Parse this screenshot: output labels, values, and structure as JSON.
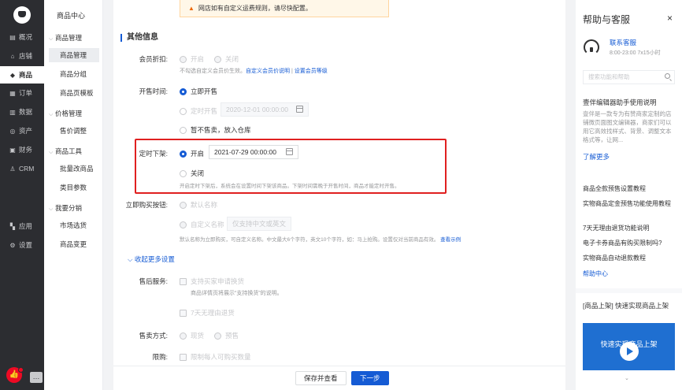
{
  "sidebar": {
    "items": [
      {
        "label": "概况",
        "icon": "dashboard-icon",
        "glyph": "▤"
      },
      {
        "label": "店铺",
        "icon": "store-icon",
        "glyph": "⌂"
      },
      {
        "label": "商品",
        "icon": "tag-icon",
        "glyph": "◆"
      },
      {
        "label": "订单",
        "icon": "order-icon",
        "glyph": "▦"
      },
      {
        "label": "数据",
        "icon": "bar-chart-icon",
        "glyph": "▥"
      },
      {
        "label": "资产",
        "icon": "asset-icon",
        "glyph": "◎"
      },
      {
        "label": "财务",
        "icon": "finance-icon",
        "glyph": "▣"
      },
      {
        "label": "CRM",
        "icon": "user-icon",
        "glyph": "♙"
      },
      {
        "label": "应用",
        "icon": "apps-icon",
        "glyph": "▚"
      },
      {
        "label": "设置",
        "icon": "settings-icon",
        "glyph": "⚙"
      }
    ],
    "bottom_icons": [
      "thumbs-up-icon",
      "chat-icon"
    ]
  },
  "subnav": {
    "title": "商品中心",
    "groups": [
      {
        "label": "商品管理",
        "items": [
          "商品管理",
          "商品分组",
          "商品页模板"
        ]
      },
      {
        "label": "价格管理",
        "items": [
          "售价调整"
        ]
      },
      {
        "label": "商品工具",
        "items": [
          "批量改商品",
          "类目参数"
        ]
      },
      {
        "label": "我要分销",
        "items": [
          "市场选货",
          "商品变更"
        ]
      }
    ]
  },
  "warning": {
    "text": "网店如有自定义运费规则，请尽快配置。"
  },
  "section": {
    "title": "其他信息"
  },
  "form": {
    "member_discount": {
      "label": "会员折扣:",
      "opt_on": "开启",
      "opt_off": "关闭",
      "help": "不勾选自定义会员价生效。",
      "link1": "自定义会员价说明",
      "sep": "|",
      "link2": "设置会员等级"
    },
    "sale_time": {
      "label": "开售时间:",
      "opt_now": "立即开售",
      "opt_scheduled": "定时开售",
      "scheduled_value": "2020-12-01 00:00:00",
      "opt_warehouse": "暂不售卖，放入仓库"
    },
    "scheduled_off": {
      "label": "定时下架:",
      "opt_on": "开启",
      "datetime_value": "2021-07-29 00:00:00",
      "opt_off": "关闭",
      "help": "开启定时下架后，系统会在设置时间下架该商品。下架时间需晚于开售时间，商品才能定时开售。"
    },
    "buy_button": {
      "label": "立即购买按钮:",
      "opt_default": "默认名称",
      "opt_custom": "自定义名称",
      "custom_placeholder": "仅支持中文或英文",
      "help": "默认名称为立即购买，可自定义名称。中文最大6个字符，英文10个字符，如：马上抢购。设置仅对当前商品有效。",
      "help_link": "查看示例"
    },
    "collapse_label": "收起更多设置",
    "after_sale": {
      "label": "售后服务:",
      "opt_exchange": "支持买家申请换货",
      "exchange_help": "商品详情页将展示“支持换货”的说明。",
      "opt_7day": "7天无理由退货"
    },
    "sale_mode": {
      "label": "售卖方式:",
      "opt_spot": "现货",
      "opt_presale": "预售"
    },
    "limit": {
      "label": "限购:",
      "opt_limit": "限制每人可购买数量"
    }
  },
  "footer": {
    "save_label": "保存并查看",
    "next_label": "下一步"
  },
  "help_panel": {
    "title": "帮助与客服",
    "close_glyph": "×",
    "service_link": "联系客服",
    "service_hours": "8:00-23:00  7x15小时",
    "search_placeholder": "搜索功能和帮助",
    "article_title": "壹伴编辑器助手使用说明",
    "article_desc": "壹伴是一款专为有赞商家定制的店铺微页面图文编辑器，商家们可以用它高效找样式、背景、调整文本格式等，让网...",
    "article_more": "了解更多",
    "links": [
      "商品全款预售设置教程",
      "实物商品定金预售功能使用教程",
      "7天无理由退货功能说明",
      "电子卡券商品有购买限制吗?",
      "实物商品自动退款教程"
    ],
    "help_center": "帮助中心",
    "video_title": "[商品上架] 快速实现商品上架",
    "video_overlay": "快速实现商品上架",
    "more_glyph": "⌄"
  }
}
